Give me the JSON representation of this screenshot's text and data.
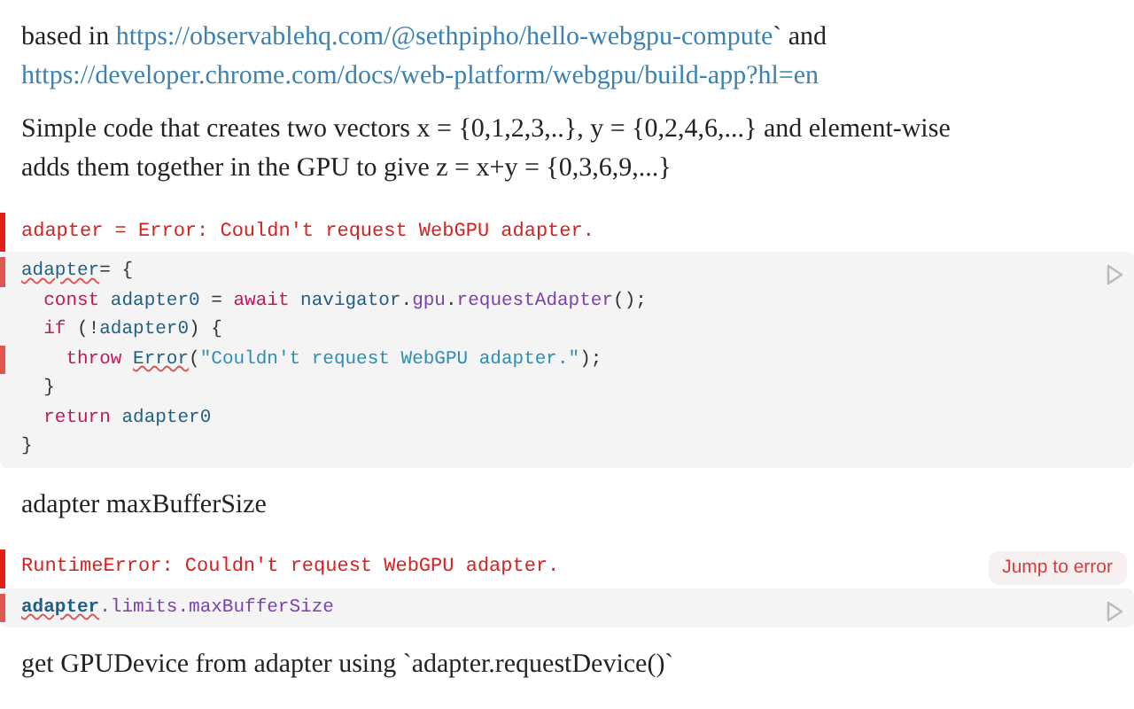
{
  "cells": [
    {
      "kind": "prose",
      "parts": [
        {
          "kind": "text",
          "text": "based in "
        },
        {
          "kind": "link",
          "text": "https://observablehq.com/@sethpipho/hello-webgpu-compute"
        },
        {
          "kind": "text",
          "text": "` and "
        },
        {
          "kind": "link",
          "text": "https://developer.chrome.com/docs/web-platform/webgpu/build-app?hl=en"
        }
      ]
    },
    {
      "kind": "prose",
      "parts": [
        {
          "kind": "text",
          "text": "Simple code that creates two vectors x = {0,1,2,3,..}, y = {0,2,4,6,...} and element-wise adds them together in the GPU to give z = x+y = {0,3,6,9,...}"
        }
      ]
    },
    {
      "kind": "code",
      "error": "adapter = Error: Couldn't request WebGPU adapter.",
      "lines": [
        {
          "marked": true,
          "tokens": [
            {
              "kind": "var",
              "text": "adapter",
              "squiggle": true
            },
            {
              "kind": "plain",
              "text": "= {",
              "squiggle": false
            }
          ]
        },
        {
          "marked": false,
          "tokens": [
            {
              "kind": "keyword",
              "text": "  const"
            },
            {
              "kind": "var",
              "text": " adapter0"
            },
            {
              "kind": "plain",
              "text": " = "
            },
            {
              "kind": "keyword",
              "text": "await"
            },
            {
              "kind": "var",
              "text": " navigator"
            },
            {
              "kind": "plain",
              "text": "."
            },
            {
              "kind": "prop",
              "text": "gpu"
            },
            {
              "kind": "plain",
              "text": "."
            },
            {
              "kind": "prop",
              "text": "requestAdapter"
            },
            {
              "kind": "plain",
              "text": "();"
            }
          ]
        },
        {
          "marked": false,
          "tokens": [
            {
              "kind": "keyword",
              "text": "  if"
            },
            {
              "kind": "plain",
              "text": " (!"
            },
            {
              "kind": "var",
              "text": "adapter0"
            },
            {
              "kind": "plain",
              "text": ") {"
            }
          ]
        },
        {
          "marked": true,
          "tokens": [
            {
              "kind": "keyword",
              "text": "    throw "
            },
            {
              "kind": "var",
              "text": "Error",
              "squiggle": true
            },
            {
              "kind": "plain",
              "text": "("
            },
            {
              "kind": "string",
              "text": "\"Couldn't request WebGPU adapter.\""
            },
            {
              "kind": "plain",
              "text": ");"
            }
          ]
        },
        {
          "marked": false,
          "tokens": [
            {
              "kind": "plain",
              "text": "  }"
            }
          ]
        },
        {
          "marked": false,
          "tokens": [
            {
              "kind": "keyword",
              "text": "  return"
            },
            {
              "kind": "var",
              "text": " adapter0"
            }
          ]
        },
        {
          "marked": false,
          "tokens": [
            {
              "kind": "plain",
              "text": "}"
            }
          ]
        }
      ]
    },
    {
      "kind": "prose",
      "parts": [
        {
          "kind": "text",
          "text": "adapter maxBufferSize"
        }
      ]
    },
    {
      "kind": "code",
      "error": "RuntimeError: Couldn't request WebGPU adapter.",
      "jump": "Jump to error",
      "lines": [
        {
          "marked": true,
          "tokens": [
            {
              "kind": "bold",
              "text": "adapter",
              "squiggle": true
            },
            {
              "kind": "prop",
              "text": ".limits"
            },
            {
              "kind": "prop",
              "text": ".maxBufferSize"
            }
          ]
        }
      ]
    },
    {
      "kind": "prose",
      "parts": [
        {
          "kind": "text",
          "text": "get GPUDevice from adapter using `adapter.requestDevice()`"
        }
      ]
    }
  ]
}
